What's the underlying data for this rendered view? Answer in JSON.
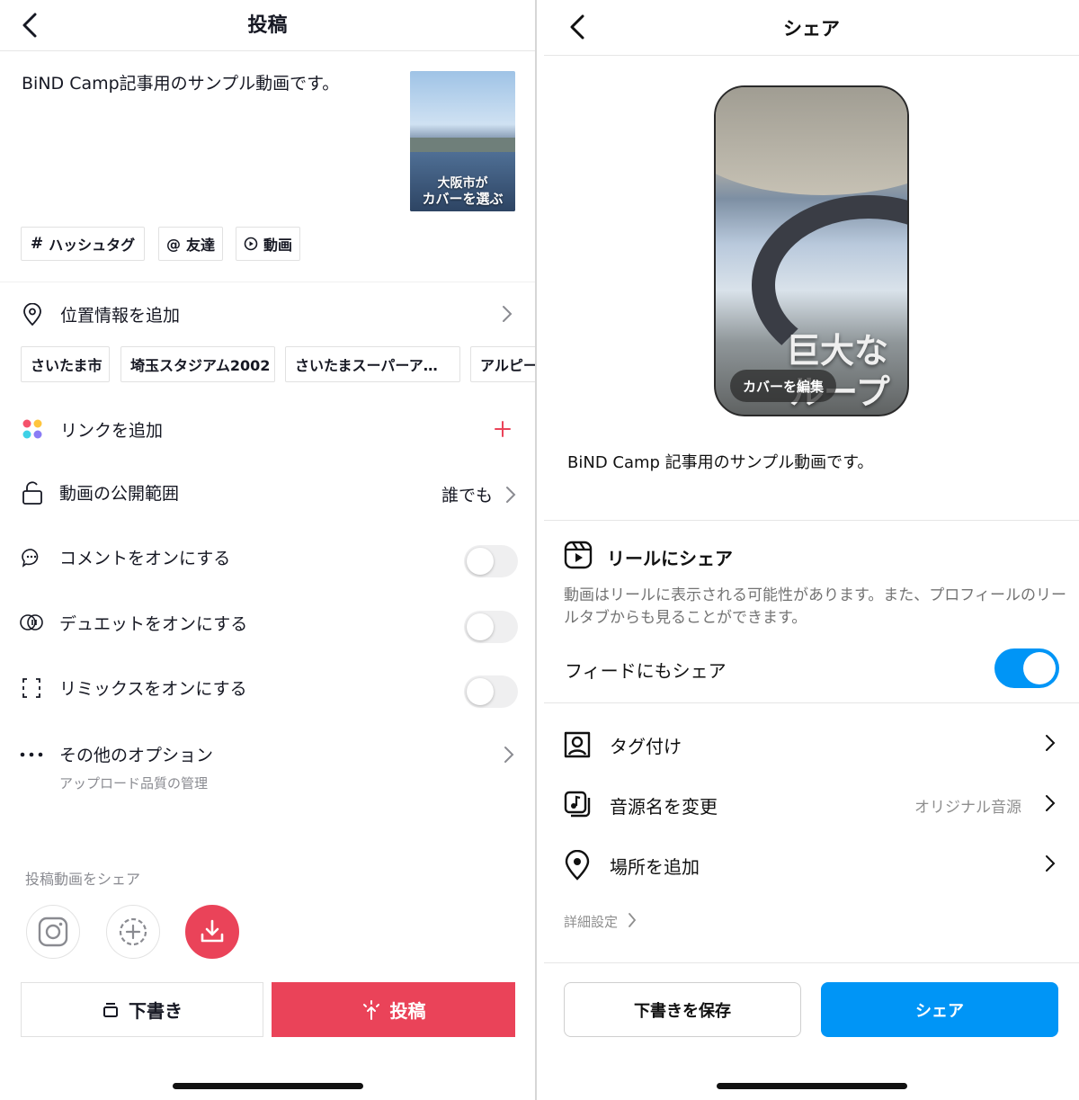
{
  "tiktok": {
    "title": "投稿",
    "caption": "BiND Camp記事用のサンプル動画です。",
    "thumbnail": {
      "overlay_line1": "大阪市が",
      "overlay_line2": "カバーを選ぶ"
    },
    "chips": {
      "hashtag": "ハッシュタグ",
      "friends": "友達",
      "video": "動画"
    },
    "location": {
      "label": "位置情報を追加",
      "suggestions": [
        "さいたま市",
        "埼玉スタジアム2002",
        "さいたまスーパーア…",
        "アルピー"
      ]
    },
    "link": {
      "label": "リンクを追加"
    },
    "visibility": {
      "label": "動画の公開範囲",
      "value": "誰でも"
    },
    "comments": {
      "label": "コメントをオンにする",
      "enabled": false
    },
    "duet": {
      "label": "デュエットをオンにする",
      "enabled": false
    },
    "remix": {
      "label": "リミックスをオンにする",
      "enabled": false
    },
    "more": {
      "label": "その他のオプション",
      "sub": "アップロード品質の管理"
    },
    "share": {
      "label": "投稿動画をシェア"
    },
    "buttons": {
      "draft": "下書き",
      "post": "投稿"
    },
    "colors": {
      "accent": "#ea4359",
      "text": "#161823"
    }
  },
  "instagram": {
    "title": "シェア",
    "cover": {
      "text_line1": "巨大な",
      "text_line2": "ループ橋！",
      "edit_label": "カバーを編集"
    },
    "caption": "BiND Camp 記事用のサンプル動画です。",
    "reels": {
      "title": "リールにシェア",
      "description": "動画はリールに表示される可能性があります。また、プロフィールのリールタブからも見ることができます。",
      "feed_label": "フィードにもシェア",
      "feed_enabled": true
    },
    "rows": {
      "tag": "タグ付け",
      "audio": "音源名を変更",
      "audio_value": "オリジナル音源",
      "place": "場所を追加"
    },
    "advanced": "詳細設定",
    "buttons": {
      "draft": "下書きを保存",
      "share": "シェア"
    },
    "colors": {
      "accent": "#0095f6"
    }
  }
}
